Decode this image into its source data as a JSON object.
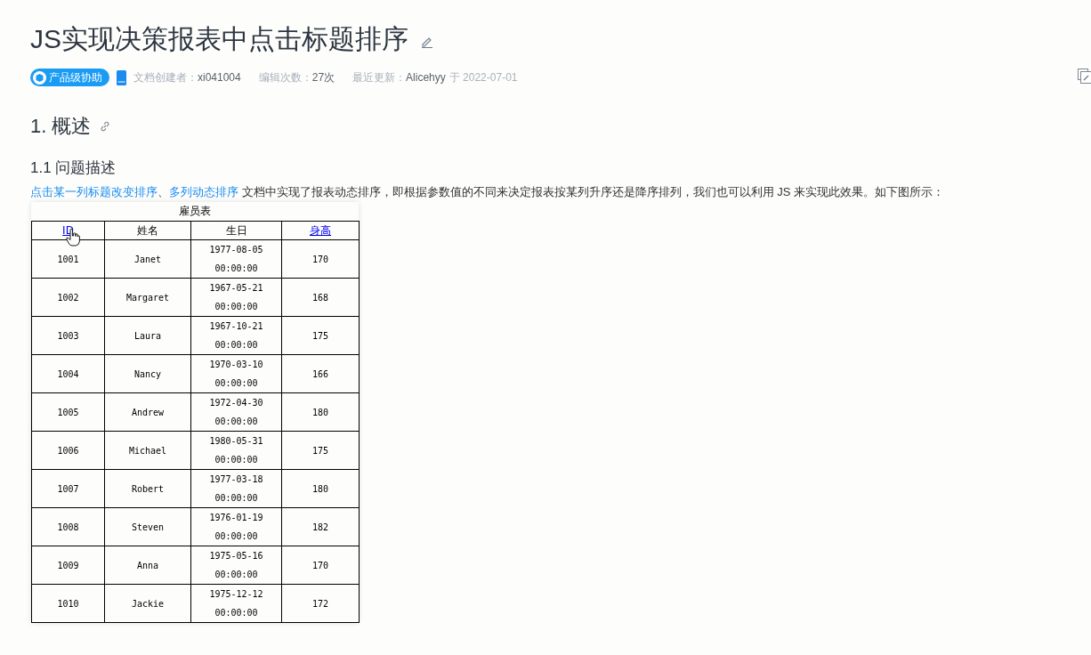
{
  "title": "JS实现决策报表中点击标题排序",
  "meta": {
    "badge": "产品级协助",
    "creator_label": "文档创建者：",
    "creator": "xi041004",
    "edits_label": "编辑次数：",
    "edits": "27次",
    "updated_label": "最近更新：",
    "updated_by": "Alicehyy",
    "updated_on": "于 2022-07-01"
  },
  "section": {
    "heading": "1. 概述"
  },
  "subsection": {
    "heading": "1.1 问题描述"
  },
  "paragraph": {
    "links": [
      "点击某一列标题改变排序",
      "多列动态排序"
    ],
    "separator": "、",
    "text": " 文档中实现了报表动态排序，即根据参数值的不同来决定报表按某列升序还是降序排列，我们也可以利用 JS 来实现此效果。如下图所示："
  },
  "table": {
    "caption": "雇员表",
    "columns": [
      {
        "label": "ID",
        "kind": "link"
      },
      {
        "label": "姓名",
        "kind": "text"
      },
      {
        "label": "生日",
        "kind": "text"
      },
      {
        "label": "身高",
        "kind": "link"
      }
    ],
    "rows": [
      [
        "1001",
        "Janet",
        "1977-08-05 00:00:00",
        "170"
      ],
      [
        "1002",
        "Margaret",
        "1967-05-21 00:00:00",
        "168"
      ],
      [
        "1003",
        "Laura",
        "1967-10-21 00:00:00",
        "175"
      ],
      [
        "1004",
        "Nancy",
        "1970-03-10 00:00:00",
        "166"
      ],
      [
        "1005",
        "Andrew",
        "1972-04-30 00:00:00",
        "180"
      ],
      [
        "1006",
        "Michael",
        "1980-05-31 00:00:00",
        "175"
      ],
      [
        "1007",
        "Robert",
        "1977-03-18 00:00:00",
        "180"
      ],
      [
        "1008",
        "Steven",
        "1976-01-19 00:00:00",
        "182"
      ],
      [
        "1009",
        "Anna",
        "1975-05-16 00:00:00",
        "170"
      ],
      [
        "1010",
        "Jackie",
        "1975-12-12 00:00:00",
        "172"
      ]
    ]
  }
}
